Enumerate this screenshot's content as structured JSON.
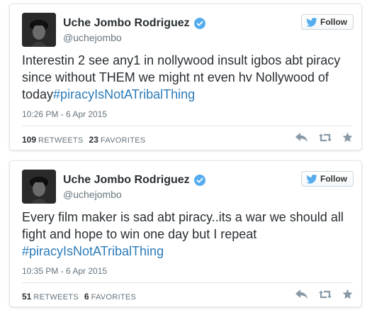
{
  "tweets": [
    {
      "name": "Uche Jombo Rodriguez",
      "handle": "@uchejombo",
      "follow_label": "Follow",
      "text_main": "Interestin 2 see any1 in nollywood insult igbos abt piracy since without THEM we might nt even hv Nollywood of today",
      "hashtag": "#piracyIsNotATribalThing",
      "timestamp": "10:26 PM - 6 Apr 2015",
      "retweets": "109",
      "retweets_label": "RETWEETS",
      "favorites": "23",
      "favorites_label": "FAVORITES"
    },
    {
      "name": "Uche Jombo Rodriguez",
      "handle": "@uchejombo",
      "follow_label": "Follow",
      "text_main": "Every film maker is sad abt piracy..its a war we should all fight and hope to win one day but I repeat",
      "hashtag": "#piracyIsNotATribalThing",
      "timestamp": "10:35 PM - 6 Apr 2015",
      "retweets": "51",
      "retweets_label": "RETWEETS",
      "favorites": "6",
      "favorites_label": "FAVORITES"
    }
  ],
  "colors": {
    "hashtag": "#2b7bb9",
    "verified": "#55acee",
    "follow_bird": "#55acee",
    "muted": "#66757f",
    "action_icon": "#8899a6"
  },
  "icons": [
    "verified-badge-icon",
    "twitter-bird-icon",
    "reply-icon",
    "retweet-icon",
    "favorite-star-icon"
  ]
}
